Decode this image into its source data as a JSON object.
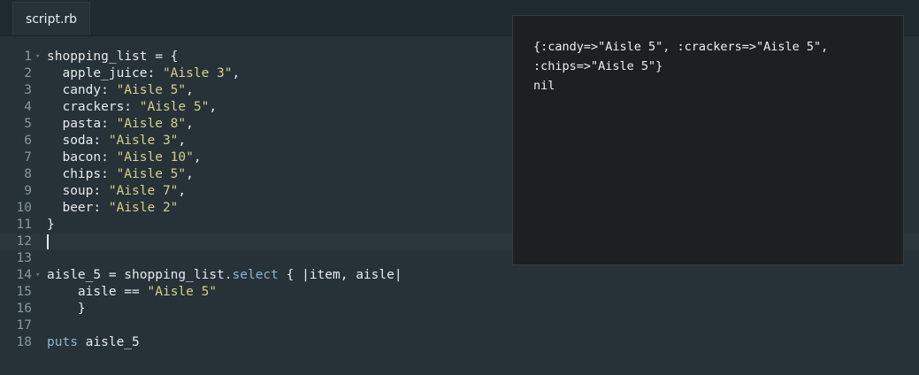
{
  "tab": {
    "label": "script.rb"
  },
  "editor": {
    "lines": [
      {
        "num": "1",
        "foldable": true,
        "segments": [
          [
            "t",
            "shopping_list = {"
          ]
        ]
      },
      {
        "num": "2",
        "foldable": false,
        "segments": [
          [
            "t",
            "  apple_juice: "
          ],
          [
            "s",
            "\"Aisle 3\""
          ],
          [
            "t",
            ","
          ]
        ]
      },
      {
        "num": "3",
        "foldable": false,
        "segments": [
          [
            "t",
            "  candy: "
          ],
          [
            "s",
            "\"Aisle 5\""
          ],
          [
            "t",
            ","
          ]
        ]
      },
      {
        "num": "4",
        "foldable": false,
        "segments": [
          [
            "t",
            "  crackers: "
          ],
          [
            "s",
            "\"Aisle 5\""
          ],
          [
            "t",
            ","
          ]
        ]
      },
      {
        "num": "5",
        "foldable": false,
        "segments": [
          [
            "t",
            "  pasta: "
          ],
          [
            "s",
            "\"Aisle 8\""
          ],
          [
            "t",
            ","
          ]
        ]
      },
      {
        "num": "6",
        "foldable": false,
        "segments": [
          [
            "t",
            "  soda: "
          ],
          [
            "s",
            "\"Aisle 3\""
          ],
          [
            "t",
            ","
          ]
        ]
      },
      {
        "num": "7",
        "foldable": false,
        "segments": [
          [
            "t",
            "  bacon: "
          ],
          [
            "s",
            "\"Aisle 10\""
          ],
          [
            "t",
            ","
          ]
        ]
      },
      {
        "num": "8",
        "foldable": false,
        "segments": [
          [
            "t",
            "  chips: "
          ],
          [
            "s",
            "\"Aisle 5\""
          ],
          [
            "t",
            ","
          ]
        ]
      },
      {
        "num": "9",
        "foldable": false,
        "segments": [
          [
            "t",
            "  soup: "
          ],
          [
            "s",
            "\"Aisle 7\""
          ],
          [
            "t",
            ","
          ]
        ]
      },
      {
        "num": "10",
        "foldable": false,
        "segments": [
          [
            "t",
            "  beer: "
          ],
          [
            "s",
            "\"Aisle 2\""
          ]
        ]
      },
      {
        "num": "11",
        "foldable": false,
        "segments": [
          [
            "t",
            "}"
          ]
        ]
      },
      {
        "num": "12",
        "foldable": false,
        "active": true,
        "caret": true,
        "segments": []
      },
      {
        "num": "13",
        "foldable": false,
        "segments": []
      },
      {
        "num": "14",
        "foldable": true,
        "segments": [
          [
            "t",
            "aisle_5 = shopping_list."
          ],
          [
            "m",
            "select"
          ],
          [
            "t",
            " { |item, aisle|"
          ]
        ]
      },
      {
        "num": "15",
        "foldable": false,
        "segments": [
          [
            "t",
            "    aisle == "
          ],
          [
            "s",
            "\"Aisle 5\""
          ]
        ]
      },
      {
        "num": "16",
        "foldable": false,
        "segments": [
          [
            "t",
            "    }"
          ]
        ]
      },
      {
        "num": "17",
        "foldable": false,
        "segments": []
      },
      {
        "num": "18",
        "foldable": false,
        "segments": [
          [
            "m",
            "puts"
          ],
          [
            "t",
            " aisle_5"
          ]
        ]
      }
    ]
  },
  "output": {
    "text": "{:candy=>\"Aisle 5\", :crackers=>\"Aisle 5\",\n:chips=>\"Aisle 5\"}\nnil"
  },
  "colors": {
    "background": "#263238",
    "string": "#d4d08a",
    "method": "#8fb4cf",
    "output_background": "#1e1f21"
  }
}
